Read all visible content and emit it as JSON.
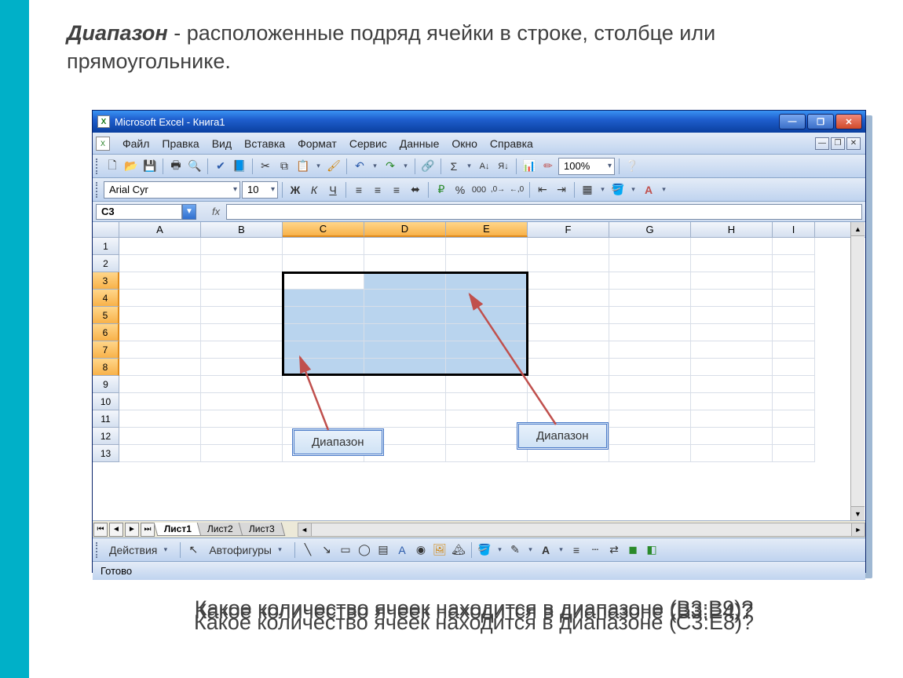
{
  "heading": {
    "term": "Диапазон",
    "rest": " - расположенные подряд ячейки в строке, столбце или прямоугольнике."
  },
  "window": {
    "title": "Microsoft Excel - Книга1"
  },
  "menu": {
    "file": "Файл",
    "edit": "Правка",
    "view": "Вид",
    "insert": "Вставка",
    "format": "Формат",
    "tools": "Сервис",
    "data": "Данные",
    "window": "Окно",
    "help": "Справка"
  },
  "toolbar1": {
    "zoom": "100%"
  },
  "toolbar2": {
    "font": "Arial Cyr",
    "size": "10",
    "bold": "Ж",
    "italic": "К",
    "underline": "Ч"
  },
  "nameBox": "C3",
  "fx": "fx",
  "columns": [
    "A",
    "B",
    "C",
    "D",
    "E",
    "F",
    "G",
    "H",
    "I"
  ],
  "rows": [
    "1",
    "2",
    "3",
    "4",
    "5",
    "6",
    "7",
    "8",
    "9",
    "10",
    "11",
    "12",
    "13"
  ],
  "selectedCols": [
    "C",
    "D",
    "E"
  ],
  "selectedRows": [
    "3",
    "4",
    "5",
    "6",
    "7",
    "8"
  ],
  "callouts": {
    "left": "Диапазон",
    "right": "Диапазон"
  },
  "sheets": {
    "s1": "Лист1",
    "s2": "Лист2",
    "s3": "Лист3"
  },
  "draw": {
    "actions": "Действия",
    "autoshapes": "Автофигуры"
  },
  "status": "Готово",
  "questions": {
    "q1": "Какое количество ячеек находится в диапазоне (B3:B9)?",
    "q2": "Какое количество ячеек находится в диапазоне (С3:E8)?",
    "q3": "Какое количество ячеек находится в диапазоне (B3:E4)?"
  }
}
